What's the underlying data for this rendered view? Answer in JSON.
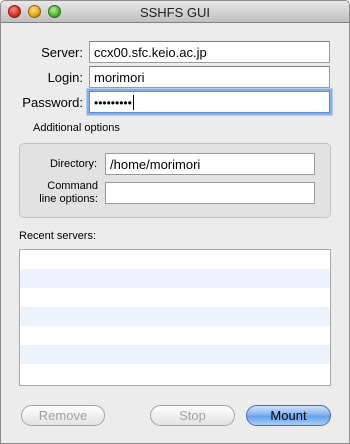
{
  "window": {
    "title": "SSHFS GUI"
  },
  "form": {
    "server_label": "Server:",
    "server_value": "ccx00.sfc.keio.ac.jp",
    "login_label": "Login:",
    "login_value": "morimori",
    "password_label": "Password:",
    "password_value": "•••••••••"
  },
  "additional": {
    "heading": "Additional options",
    "directory_label": "Directory:",
    "directory_value": "/home/morimori",
    "cmd_label_line1": "Command",
    "cmd_label_line2": "line options:",
    "cmd_value": ""
  },
  "recent": {
    "heading": "Recent servers:",
    "rows": [
      "",
      "",
      "",
      "",
      "",
      "",
      ""
    ]
  },
  "buttons": {
    "remove": "Remove",
    "stop": "Stop",
    "mount": "Mount"
  },
  "colors": {
    "window_bg": "#ececec",
    "accent_blue": "#5f9ee9",
    "list_alt_row": "#edf3fe"
  }
}
